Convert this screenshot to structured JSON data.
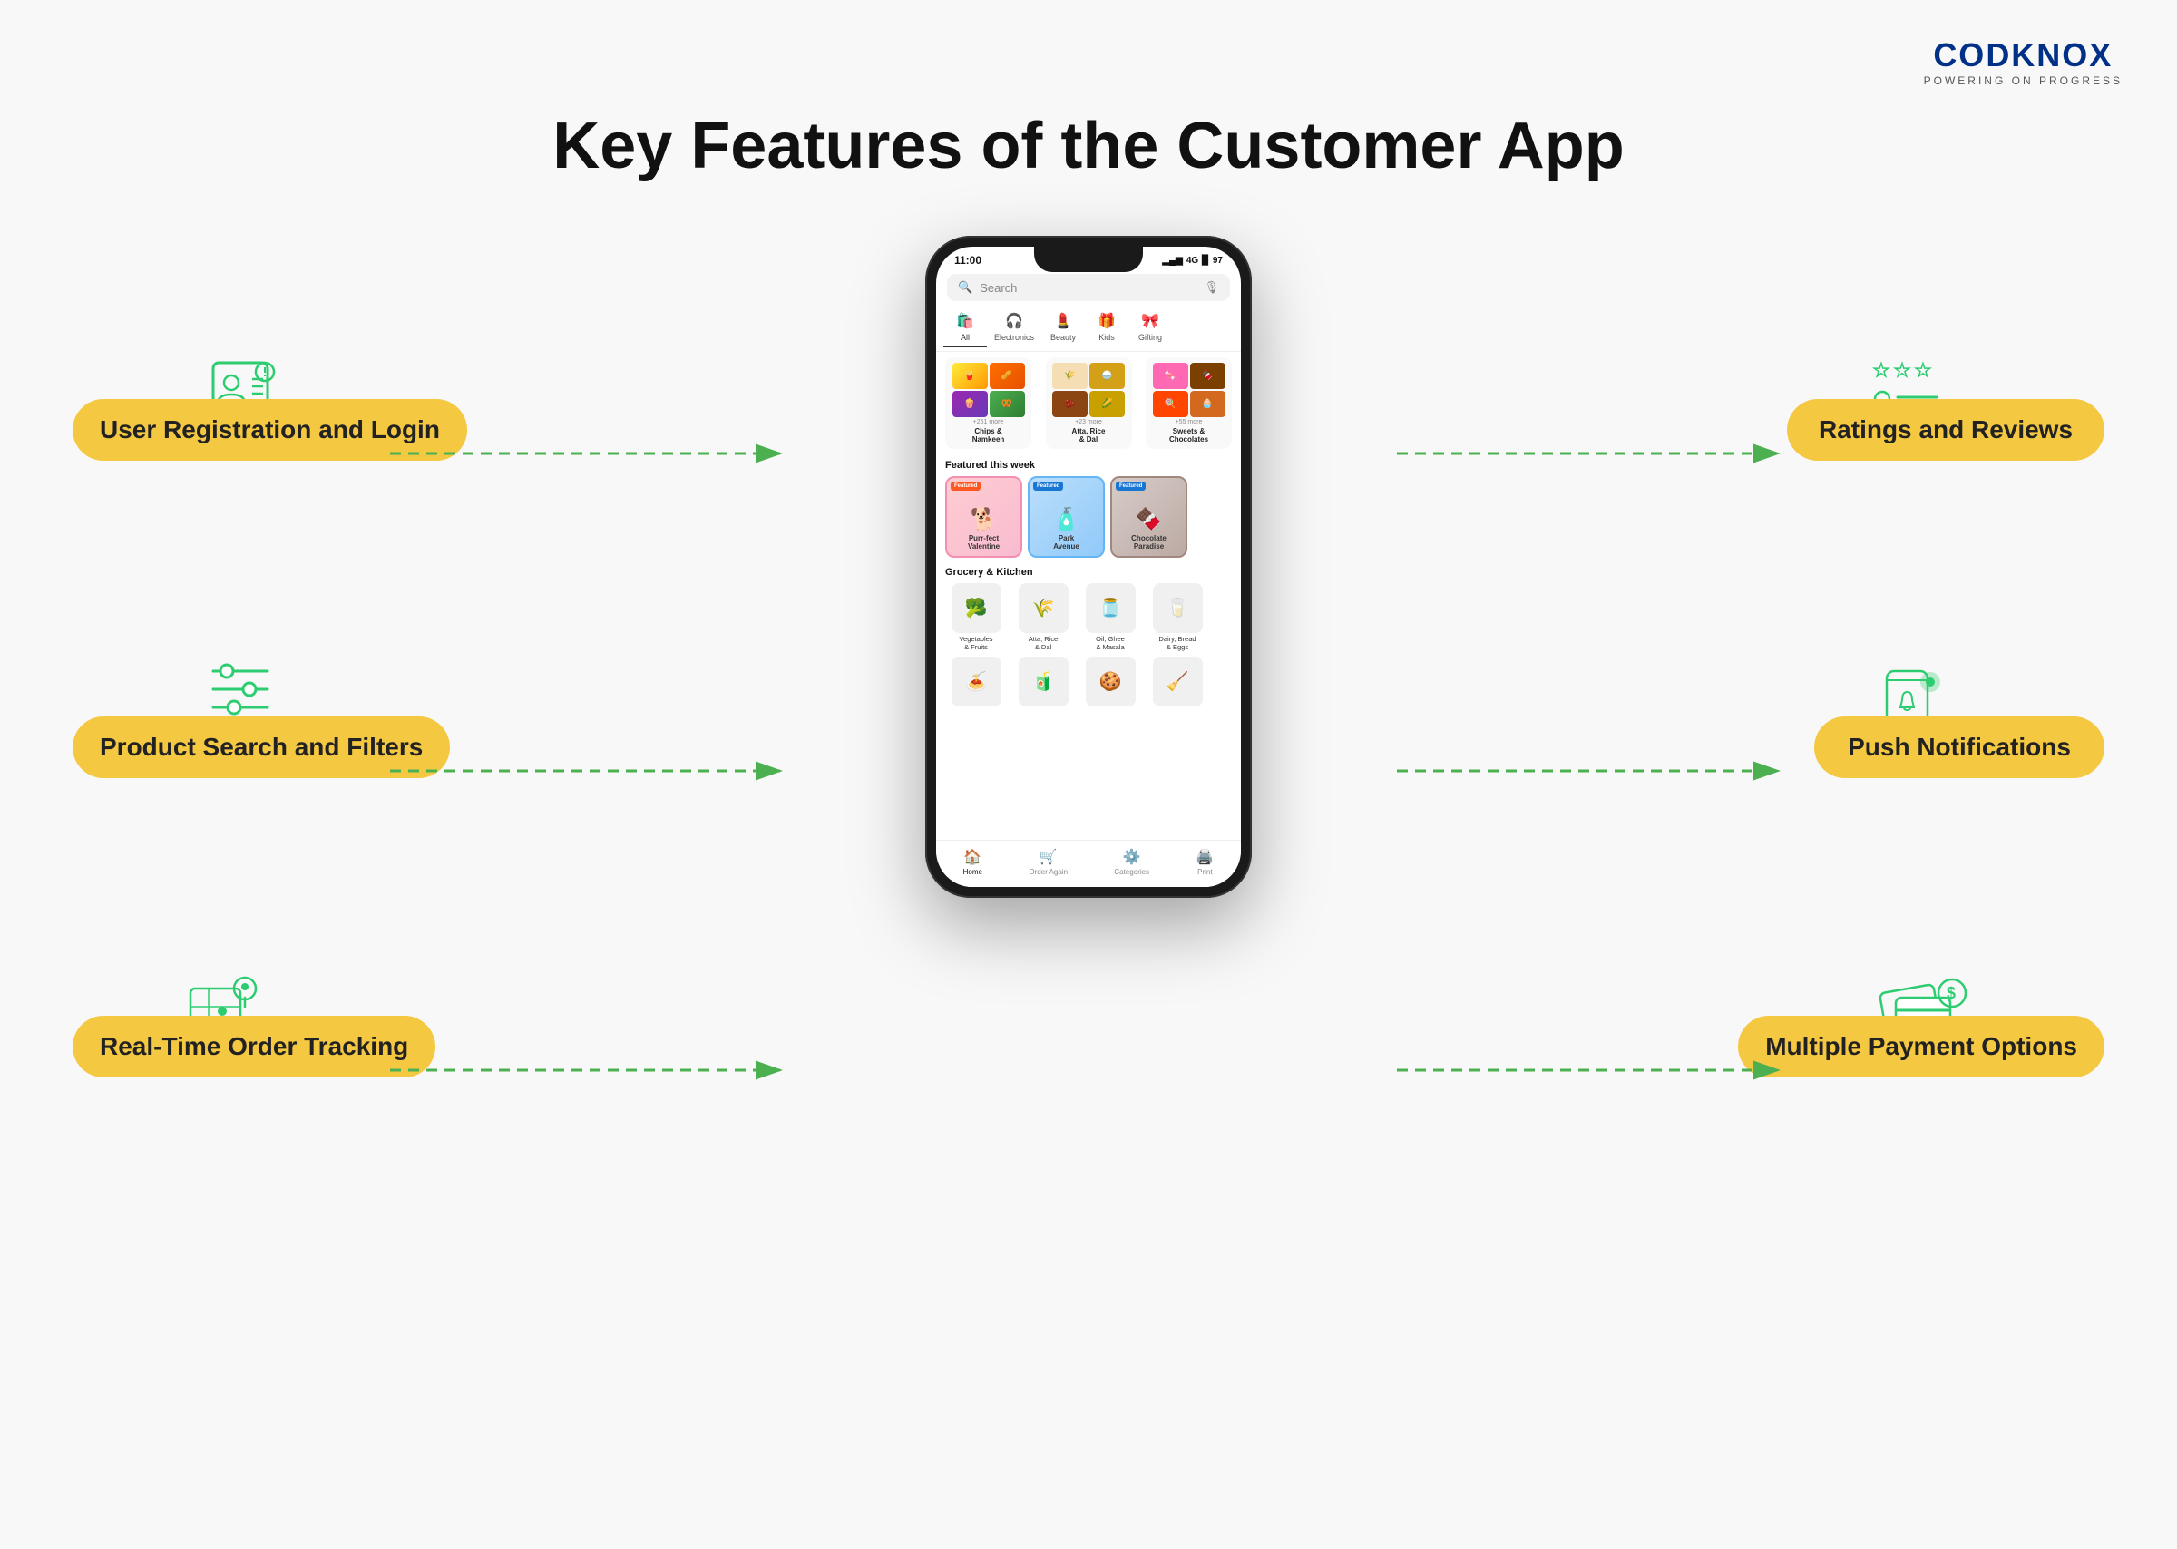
{
  "logo": {
    "text": "CODKNOX",
    "subtitle": "POWERING ON PROGRESS"
  },
  "page": {
    "title": "Key Features of the Customer App"
  },
  "phone": {
    "status": {
      "time": "11:00",
      "signal": "4G",
      "battery": "97"
    },
    "search_placeholder": "Search",
    "categories": [
      {
        "label": "All",
        "icon": "🛍️",
        "active": true
      },
      {
        "label": "Electronics",
        "icon": "🎧"
      },
      {
        "label": "Beauty",
        "icon": "💄"
      },
      {
        "label": "Kids",
        "icon": "🎁"
      },
      {
        "label": "Gifting",
        "icon": "🎀"
      }
    ],
    "products": [
      {
        "name": "Chips & Namkeen",
        "more": "+261 more"
      },
      {
        "name": "Atta, Rice & Dal",
        "more": "+23 more"
      },
      {
        "name": "Sweets & Chocolates",
        "more": "+55 more"
      }
    ],
    "featured_title": "Featured this week",
    "featured": [
      {
        "name": "Purr-fect Valentine",
        "tag": "Featured",
        "color": "pink",
        "emoji": "🐕"
      },
      {
        "name": "Park Avenue",
        "tag": "Featured",
        "color": "blue",
        "emoji": "🧴"
      },
      {
        "name": "Chocolate Paradise",
        "tag": "Featured",
        "color": "brown",
        "emoji": "🍫"
      }
    ],
    "grocery_title": "Grocery & Kitchen",
    "grocery": [
      {
        "name": "Vegetables & Fruits",
        "emoji": "🥦"
      },
      {
        "name": "Atta, Rice & Dal",
        "emoji": "🌾"
      },
      {
        "name": "Oil, Ghee & Masala",
        "emoji": "🫙"
      },
      {
        "name": "Dairy, Bread & Eggs",
        "emoji": "🥛"
      }
    ],
    "nav": [
      {
        "label": "Home",
        "icon": "🏠",
        "active": true
      },
      {
        "label": "Order Again",
        "icon": "🛒"
      },
      {
        "label": "Categories",
        "icon": "⚙️"
      },
      {
        "label": "Print",
        "icon": "🖨️"
      }
    ]
  },
  "features": {
    "left": [
      {
        "id": "user-registration",
        "label": "User Registration\nand Login",
        "icon_type": "user-card"
      },
      {
        "id": "product-search",
        "label": "Product Search\nand Filters",
        "icon_type": "filter-sliders"
      },
      {
        "id": "realtime-tracking",
        "label": "Real-Time\nOrder Tracking",
        "icon_type": "map-pin"
      }
    ],
    "right": [
      {
        "id": "ratings-reviews",
        "label": "Ratings and Reviews",
        "icon_type": "star-rating"
      },
      {
        "id": "push-notifications",
        "label": "Push Notifications",
        "icon_type": "bell-notification"
      },
      {
        "id": "payment-options",
        "label": "Multiple Payment\nOptions",
        "icon_type": "payment-cards"
      }
    ]
  },
  "colors": {
    "accent_yellow": "#f5c842",
    "arrow_green": "#4caf50",
    "icon_green": "#2ecc71",
    "brand_blue": "#003087"
  }
}
